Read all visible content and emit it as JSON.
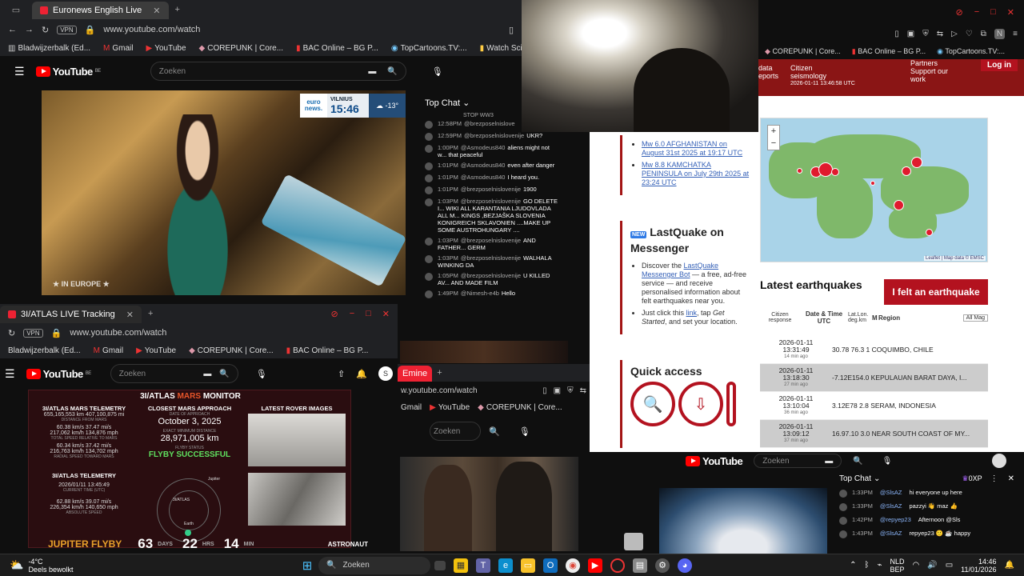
{
  "win1": {
    "tab_title": "Euronews English Live",
    "url": "www.youtube.com/watch",
    "vpn": "VPN",
    "bookmarks": [
      "Bladwijzerbalk (Ed...",
      "Gmail",
      "YouTube",
      "COREPUNK | Core...",
      "BAC Online – BG P...",
      "TopCartoons.TV:...",
      "Watch Sci-Fi Cart..."
    ],
    "yt_logo": "YouTube",
    "yt_region": "BE",
    "search_placeholder": "Zoeken",
    "euronews": {
      "logo": "euro news.",
      "city": "VILNIUS",
      "time": "15:46",
      "temp": "-13°"
    },
    "in_europe": "IN EUROPE"
  },
  "chat1": {
    "header": "Top Chat",
    "top_line": "STOP WW3",
    "messages": [
      {
        "time": "12:58PM",
        "author": "@brezposelnislove",
        "text": ""
      },
      {
        "time": "12:59PM",
        "author": "@brezposelnislovenije",
        "text": "UKR?"
      },
      {
        "time": "1:00PM",
        "author": "@Asmodeus840",
        "text": "aliens might not w... that peaceful"
      },
      {
        "time": "1:01PM",
        "author": "@Asmodeus840",
        "text": "even after danger"
      },
      {
        "time": "1:01PM",
        "author": "@Asmodeus840",
        "text": "I heard you."
      },
      {
        "time": "1:01PM",
        "author": "@brezposelnislovenije",
        "text": "1900"
      },
      {
        "time": "1:03PM",
        "author": "@brezposelnislovenije",
        "text": "GO DELETE I... WIKI ALL KARANTANIA LJUDOVLADA ALL M... KINGS ,BEZJAŠKA SLOVENIA KONIGREICH SKLAVONIEN ....MAKE UP SOME AUSTROHUNGARY ...."
      },
      {
        "time": "1:03PM",
        "author": "@brezposelnislovenije",
        "text": "AND FATHER... GERM"
      },
      {
        "time": "1:03PM",
        "author": "@brezposelnislovenije",
        "text": "WALHALA WINKING DA"
      },
      {
        "time": "1:05PM",
        "author": "@brezposelnislovenije",
        "text": "U KILLED AV... AND MADE FILM"
      },
      {
        "time": "1:49PM",
        "author": "@Nimesh-e4b",
        "text": "Hello"
      }
    ]
  },
  "win3": {
    "bookmarks": [
      "COREPUNK | Core...",
      "BAC Online – BG P...",
      "TopCartoons.TV:..."
    ],
    "emsc_nav_left": [
      "Citizen",
      "seismology"
    ],
    "emsc_nav_left2": [
      "data",
      "eports"
    ],
    "emsc_nav_right": [
      "Partners",
      "Support our work"
    ],
    "emsc_time": "2026-01-11 13:46:58 UTC",
    "login": "Log in"
  },
  "emsc_left": {
    "links": [
      "Mw 6.0 AFGHANISTAN on August 31st 2025 at 19:17 UTC",
      "Mw 8.8 KAMCHATKA PENINSULA on July 29th 2025 at 23:24 UTC"
    ],
    "new_badge": "NEW",
    "lastquake_title": "LastQuake on Messenger",
    "lq_item1_pre": "Discover the ",
    "lq_item1_link": "LastQuake Messenger Bot",
    "lq_item1_post": " — a free, ad-free service — and receive personalised information about felt earthquakes near you.",
    "lq_item2_pre": "Just click this ",
    "lq_item2_link": "link",
    "lq_item2_mid": ", tap ",
    "lq_item2_em": "Get Started",
    "lq_item2_post": ", and set your location.",
    "quick_access": "Quick access"
  },
  "emsc_right": {
    "map_attrib": "Leaflet | Map data © EMSC",
    "latest_title": "Latest earthquakes",
    "felt_button": "I felt an earthquake",
    "cols": {
      "citizen": "Citizen response",
      "datetime": "Date & Time UTC",
      "latlon": "Lat.Lon. deg.km",
      "mag": "M",
      "region": "Region",
      "filter": "All Mag"
    },
    "rows": [
      {
        "date": "2026-01-11",
        "time": "13:31:49",
        "ago": "14 min ago",
        "data": "30.78  76.3  1 COQUIMBO, CHILE"
      },
      {
        "date": "2026-01-11",
        "time": "13:18:30",
        "ago": "27 min ago",
        "data": "-7.12E154.0 KEPULAUAN BARAT DAYA, I..."
      },
      {
        "date": "2026-01-11",
        "time": "13:10:04",
        "ago": "36 min ago",
        "data": "3.12E78  2.8 SERAM, INDONESIA"
      },
      {
        "date": "2026-01-11",
        "time": "13:09:12",
        "ago": "37 min ago",
        "data": "16.97.10  3.0 NEAR SOUTH COAST OF MY..."
      }
    ]
  },
  "win2": {
    "tab_title": "3I/ATLAS LIVE Tracking",
    "url": "www.youtube.com/watch",
    "vpn": "VPN",
    "bookmarks": [
      "Bladwijzerbalk (Ed...",
      "Gmail",
      "YouTube",
      "COREPUNK | Core...",
      "BAC Online – BG P..."
    ],
    "yt_logo": "YouTube",
    "yt_region": "BE",
    "search_placeholder": "Zoeken",
    "avatar": "S",
    "monitor_title_a": "3I/ATLAS ",
    "monitor_title_b": "MARS",
    "monitor_title_c": " MONITOR",
    "mars_telemetry": "3I/ATLAS MARS TELEMETRY",
    "t1": "655,165,553 km   407,100,875 mi",
    "t1l": "DISTANCE FROM MARS",
    "t2": "60.38 km/s   37.47 mi/s",
    "t3": "217,062 km/h   134,876 mph",
    "t3l": "TOTAL SPEED RELATIVE TO MARS",
    "t4": "60.34 km/s   37.42 mi/s",
    "t5": "216,763 km/h   134,702 mph",
    "t5l": "RADIAL SPEED TOWARD MARS",
    "closest": "CLOSEST MARS APPROACH",
    "date_label": "DATE OF APPROACH",
    "date": "October 3, 2025",
    "min_label": "EXACT MINIMUM DISTANCE",
    "min": "28,971,005 km",
    "status_label": "FLYBY STATUS",
    "status": "FLYBY SUCCESSFUL",
    "rover": "LATEST ROVER IMAGES",
    "telemetry": "3I/ATLAS TELEMETRY",
    "utc": "2026/01/11 13:45:49",
    "utc_label": "CURRENT TIME (UTC)",
    "speed1": "62.88 km/s   39.07 mi/s",
    "speed2": "226,354 km/h   140,650 mph",
    "speed_label": "ABSOLUTE SPEED",
    "orbit": {
      "jupiter": "Jupiter",
      "atlas": "3I/ATLAS",
      "earth": "Earth"
    },
    "flyby": "JUPITER FLYBY",
    "days": "63",
    "days_l": "DAYS",
    "hrs": "22",
    "hrs_l": "HRS",
    "min2": "14",
    "min2_l": "MIN",
    "astronaut": "ASTRONAUT"
  },
  "win4": {
    "tab_title": "Emine",
    "url": "w.youtube.com/watch",
    "bookmarks": [
      "Gmail",
      "YouTube",
      "COREPUNK | Core..."
    ],
    "search_placeholder": "Zoeken"
  },
  "win5": {
    "yt_logo": "YouTube",
    "search_placeholder": "Zoeken",
    "chat_header": "Top Chat",
    "points": "0XP",
    "messages": [
      {
        "time": "1:33PM",
        "author": "@SlsAZ",
        "text": "hi everyone up here"
      },
      {
        "time": "1:33PM",
        "author": "@SlsAZ",
        "text": "pazzyi 👋 maz 👍"
      },
      {
        "time": "1:42PM",
        "author": "@repyep23",
        "text": "Afternoon @Sls"
      },
      {
        "time": "1:43PM",
        "author": "@SlsAZ",
        "text": "repyep23 🙂 ☕ happy"
      }
    ]
  },
  "taskbar": {
    "weather_temp": "-4°C",
    "weather_desc": "Deels bewolkt",
    "search": "Zoeken",
    "lang1": "NLD",
    "lang2": "BEP",
    "time": "14:46",
    "date": "11/01/2026"
  }
}
